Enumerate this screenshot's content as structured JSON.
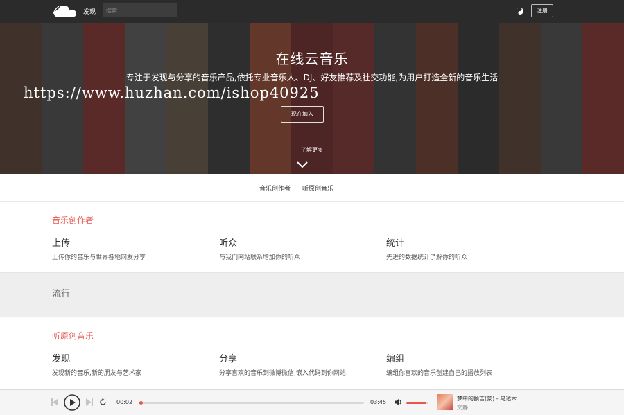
{
  "nav": {
    "discover": "发现",
    "search_placeholder": "搜索...",
    "register": "注册"
  },
  "hero": {
    "title": "在线云音乐",
    "subtitle": "专注于发现与分享的音乐产品,依托专业音乐人、DJ、好友推荐及社交功能,为用户打造全新的音乐生活",
    "watermark": "https://www.huzhan.com/ishop40925",
    "join": "现在加入",
    "learn_more": "了解更多"
  },
  "anchors": [
    "音乐创作者",
    "听原创音乐"
  ],
  "creators": {
    "title": "音乐创作者",
    "features": [
      {
        "title": "上传",
        "desc": "上传你的音乐与世界各地网友分享"
      },
      {
        "title": "听众",
        "desc": "与我们网站联系增加你的听众"
      },
      {
        "title": "统计",
        "desc": "先进的数据统计了解你的听众"
      }
    ]
  },
  "popular": {
    "title": "流行"
  },
  "original": {
    "title": "听原创音乐",
    "features": [
      {
        "title": "发现",
        "desc": "发现新的音乐,新的朋友与艺术家"
      },
      {
        "title": "分享",
        "desc": "分享喜欢的音乐到微博微信,嵌入代码到你网站"
      },
      {
        "title": "编组",
        "desc": "编组你喜欢的音乐创建自己的播放列表"
      }
    ]
  },
  "player": {
    "current_time": "00:02",
    "total_time": "03:45",
    "progress_fraction": 0.01,
    "volume_fraction": 0.9,
    "song_title": "梦中的额吉(蒙) - 乌达木",
    "artist": "文静",
    "accent_color": "#e8574f"
  },
  "icons": {
    "logo": "cloud-logo-icon",
    "theme": "theme-toggle-icon",
    "chevron": "chevron-down-icon",
    "prev": "previous-icon",
    "play": "play-icon",
    "next": "next-icon",
    "loop": "repeat-icon",
    "volume": "volume-icon"
  }
}
